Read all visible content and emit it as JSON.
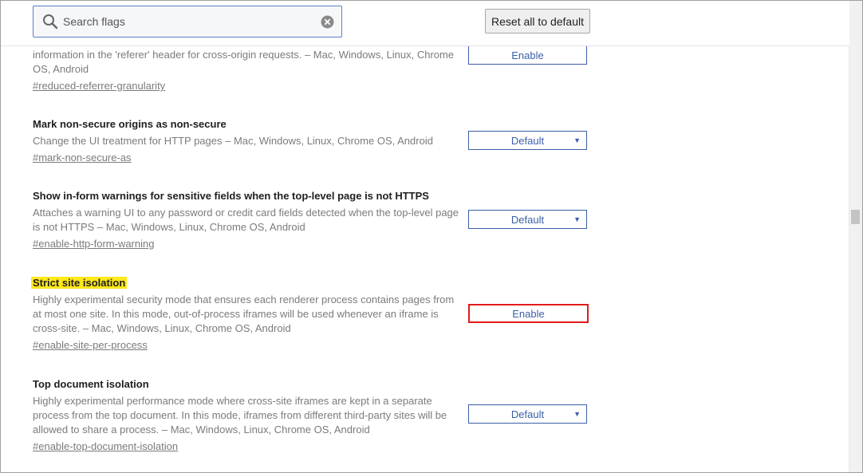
{
  "search": {
    "placeholder": "Search flags"
  },
  "header": {
    "reset_label": "Reset all to default"
  },
  "experiments": [
    {
      "title": "",
      "description_lines": [
        "information in the 'referer' header for cross-origin requests.  – Mac, Windows, Linux, Chrome",
        "OS, Android"
      ],
      "anchor": "#reduced-referrer-granularity",
      "control": {
        "type": "button",
        "label": "Enable"
      }
    },
    {
      "title": "Mark non-secure origins as non-secure",
      "description_lines": [
        "Change the UI treatment for HTTP pages  – Mac, Windows, Linux, Chrome OS, Android"
      ],
      "anchor": "#mark-non-secure-as",
      "control": {
        "type": "select",
        "label": "Default"
      }
    },
    {
      "title": "Show in-form warnings for sensitive fields when the top-level page is not HTTPS",
      "description_lines": [
        "Attaches a warning UI to any password or credit card fields detected when the top-level page",
        "is not HTTPS  – Mac, Windows, Linux, Chrome OS, Android"
      ],
      "anchor": "#enable-http-form-warning",
      "control": {
        "type": "select",
        "label": "Default"
      }
    },
    {
      "title": "Strict site isolation",
      "description_lines": [
        "Highly experimental security mode that ensures each renderer process contains pages from",
        "at most one site. In this mode, out-of-process iframes will be used whenever an iframe is",
        "cross-site.  – Mac, Windows, Linux, Chrome OS, Android"
      ],
      "anchor": "#enable-site-per-process",
      "control": {
        "type": "button",
        "label": "Enable"
      }
    },
    {
      "title": "Top document isolation",
      "description_lines": [
        "Highly experimental performance mode where cross-site iframes are kept in a separate",
        "process from the top document. In this mode, iframes from different third-party sites will be",
        "allowed to share a process.  – Mac, Windows, Linux, Chrome OS, Android"
      ],
      "anchor": "#enable-top-document-isolation",
      "control": {
        "type": "select",
        "label": "Default"
      }
    }
  ],
  "colors": {
    "highlight": "#ffe81a",
    "selected_outline": "#e21b1b",
    "accent": "#3b5fa8"
  }
}
